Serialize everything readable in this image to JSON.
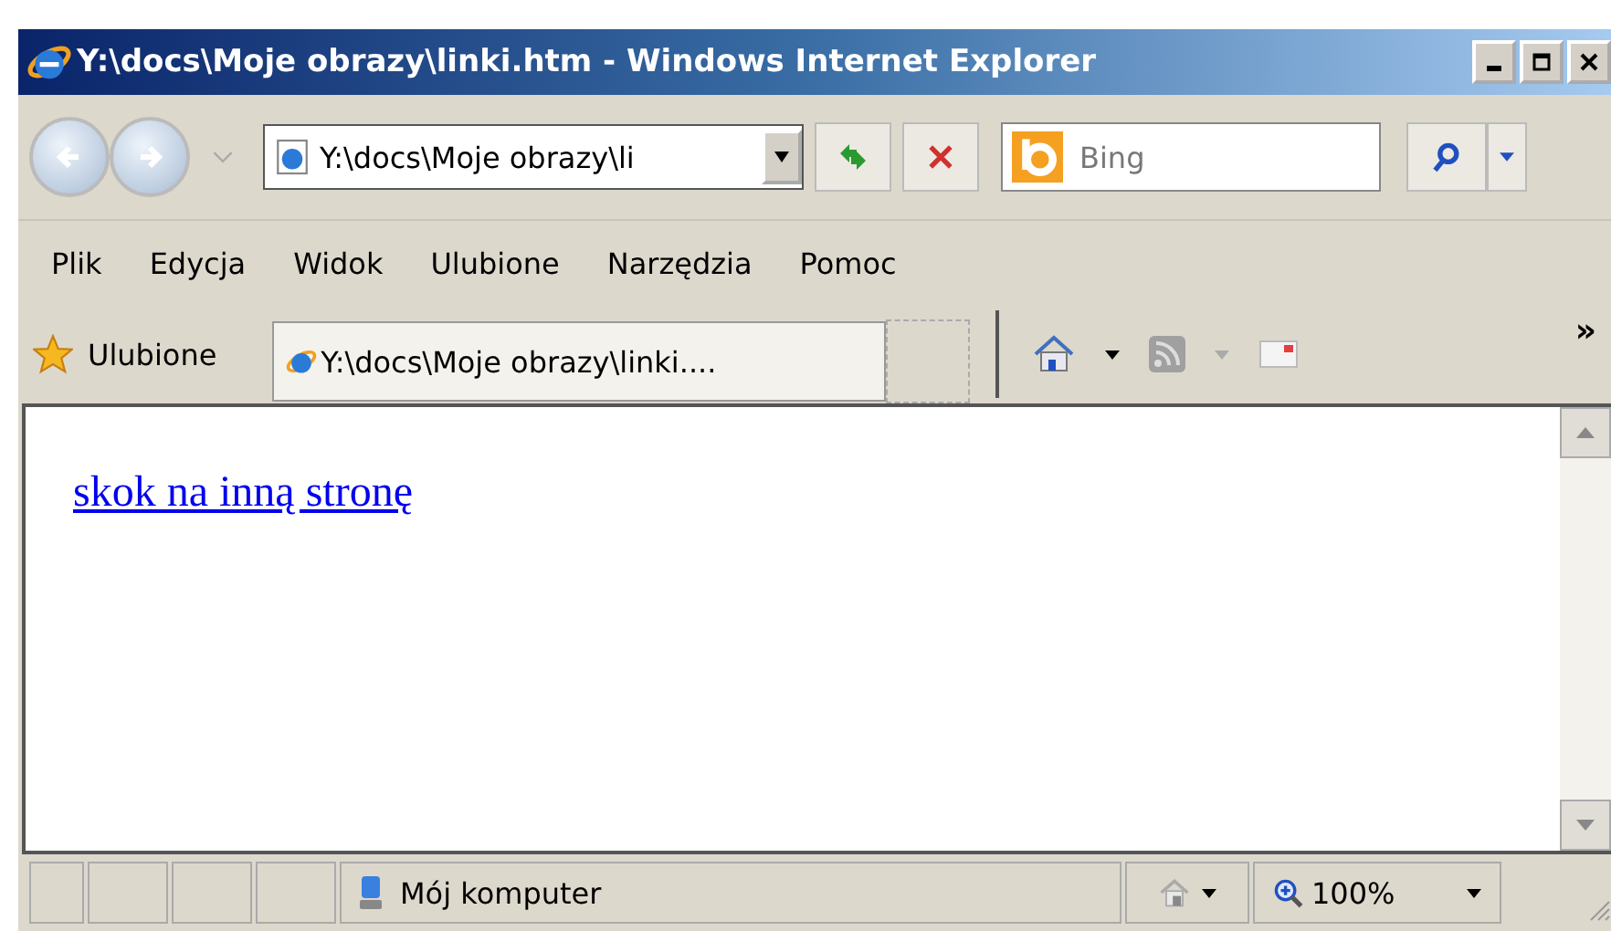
{
  "window": {
    "title": "Y:\\docs\\Moje obrazy\\linki.htm - Windows Internet Explorer"
  },
  "address": {
    "value": "Y:\\docs\\Moje obrazy\\li"
  },
  "search": {
    "placeholder": "Bing"
  },
  "menu": [
    "Plik",
    "Edycja",
    "Widok",
    "Ulubione",
    "Narzędzia",
    "Pomoc"
  ],
  "favorites": {
    "label": "Ulubione",
    "tab": "Y:\\docs\\Moje obrazy\\linki....",
    "more": "»"
  },
  "content": {
    "link": "skok na inną stronę"
  },
  "status_bar": {
    "zone": "Mój komputer",
    "zoom": "100%"
  }
}
